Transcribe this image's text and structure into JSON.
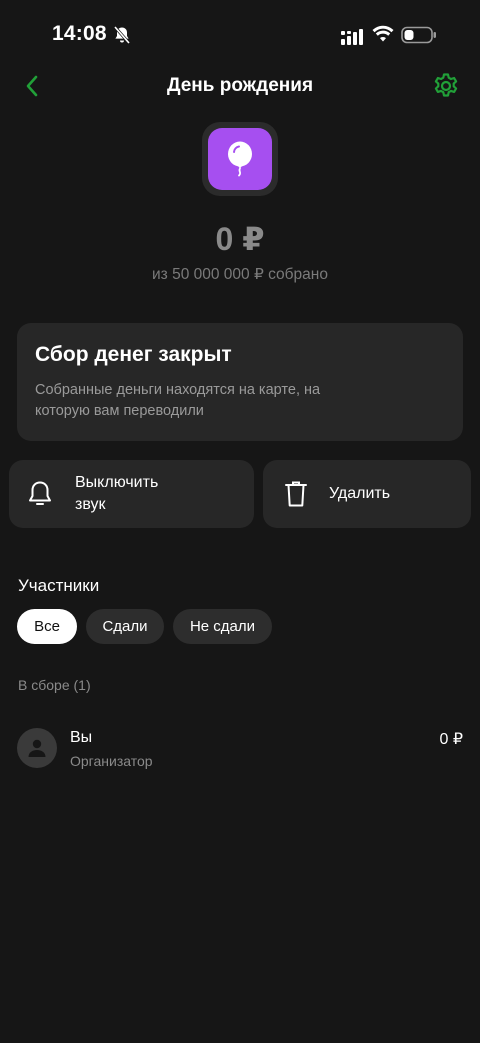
{
  "status_bar": {
    "time": "14:08",
    "icons": [
      "bell-muted-icon",
      "signal-icon",
      "wifi-icon",
      "battery-icon"
    ]
  },
  "header": {
    "title": "День рождения",
    "back_icon": "chevron-left-icon",
    "settings_icon": "gear-icon",
    "accent_color": "#21a038"
  },
  "goal": {
    "icon": "balloon-icon",
    "icon_color": "#a64ff0",
    "amount": "0 ₽",
    "subtitle": "из 50 000 000 ₽ собрано"
  },
  "closed_card": {
    "title": "Сбор денег закрыт",
    "text": "Собранные деньги находятся на карте, на которую вам переводили"
  },
  "actions": {
    "mute_label": "Выключить звук",
    "mute_icon": "bell-icon",
    "delete_label": "Удалить",
    "delete_icon": "trash-icon"
  },
  "participants": {
    "title": "Участники",
    "filters": [
      {
        "label": "Все",
        "active": true
      },
      {
        "label": "Сдали",
        "active": false
      },
      {
        "label": "Не сдали",
        "active": false
      }
    ],
    "group_label": "В сборе (1)",
    "items": [
      {
        "name": "Вы",
        "role": "Организатор",
        "amount": "0 ₽",
        "avatar_icon": "user-icon"
      }
    ]
  }
}
